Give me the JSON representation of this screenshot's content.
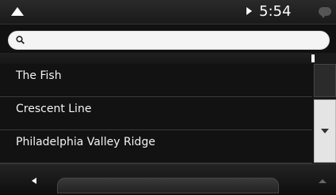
{
  "status_bar": {
    "title": "",
    "clock": "5:54",
    "clock_suffix": "",
    "icons": [
      "navigation-arrow-icon",
      "gps-icon",
      "message-icon"
    ]
  },
  "search": {
    "placeholder": "",
    "value": ""
  },
  "list": {
    "header_label": "",
    "items": [
      {
        "title": "The Fish",
        "subtitle": ""
      },
      {
        "title": "Crescent Line",
        "subtitle": ""
      },
      {
        "title": "Philadelphia Valley Ridge",
        "subtitle": ""
      }
    ]
  },
  "bottom_bar": {
    "label": "",
    "keyboard_label": ""
  },
  "colors": {
    "background": "#111111",
    "search_box": "#f4f4f4",
    "scroll_button": "#e4e4e4",
    "text": "#ffffff"
  }
}
